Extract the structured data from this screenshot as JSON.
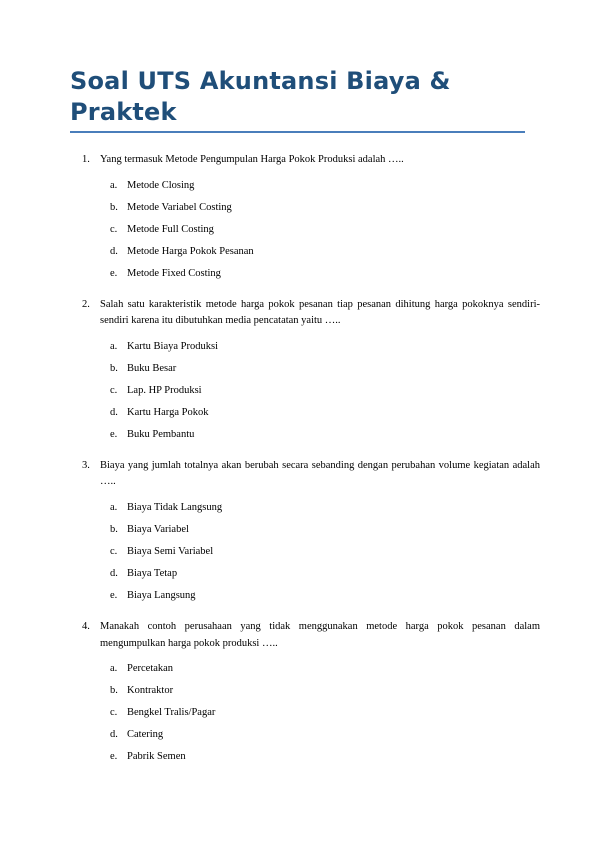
{
  "document": {
    "title": "Soal UTS Akuntansi Biaya &\nPraktek",
    "title_color": "#1F4E79",
    "rule_color": "#4A7EBB",
    "background_color": "#FFFFFF",
    "questions": [
      {
        "number": "1.",
        "stem": "Yang termasuk Metode Pengumpulan Harga Pokok Produksi adalah …..",
        "options": [
          {
            "letter": "a.",
            "text": "Metode Closing"
          },
          {
            "letter": "b.",
            "text": "Metode Variabel Costing"
          },
          {
            "letter": "c.",
            "text": "Metode Full Costing"
          },
          {
            "letter": "d.",
            "text": "Metode Harga Pokok Pesanan"
          },
          {
            "letter": "e.",
            "text": "Metode Fixed Costing"
          }
        ]
      },
      {
        "number": "2.",
        "stem": "Salah satu karakteristik metode harga pokok pesanan tiap pesanan dihitung harga pokoknya sendiri-sendiri karena itu dibutuhkan media pencatatan yaitu …..",
        "options": [
          {
            "letter": "a.",
            "text": "Kartu Biaya Produksi"
          },
          {
            "letter": "b.",
            "text": "Buku Besar"
          },
          {
            "letter": "c.",
            "text": "Lap. HP Produksi"
          },
          {
            "letter": "d.",
            "text": "Kartu Harga Pokok"
          },
          {
            "letter": "e.",
            "text": "Buku Pembantu"
          }
        ]
      },
      {
        "number": "3.",
        "stem": "Biaya yang jumlah totalnya akan berubah secara sebanding dengan perubahan volume kegiatan adalah …..",
        "options": [
          {
            "letter": "a.",
            "text": "Biaya Tidak Langsung"
          },
          {
            "letter": "b.",
            "text": "Biaya Variabel"
          },
          {
            "letter": "c.",
            "text": "Biaya Semi Variabel"
          },
          {
            "letter": "d.",
            "text": "Biaya Tetap"
          },
          {
            "letter": "e.",
            "text": "Biaya Langsung"
          }
        ]
      },
      {
        "number": "4.",
        "stem": "Manakah contoh perusahaan yang tidak menggunakan metode harga pokok pesanan dalam mengumpulkan harga pokok produksi …..",
        "options": [
          {
            "letter": "a.",
            "text": "Percetakan"
          },
          {
            "letter": "b.",
            "text": "Kontraktor"
          },
          {
            "letter": "c.",
            "text": "Bengkel Tralis/Pagar"
          },
          {
            "letter": "d.",
            "text": "Catering"
          },
          {
            "letter": "e.",
            "text": "Pabrik Semen"
          }
        ]
      }
    ]
  }
}
